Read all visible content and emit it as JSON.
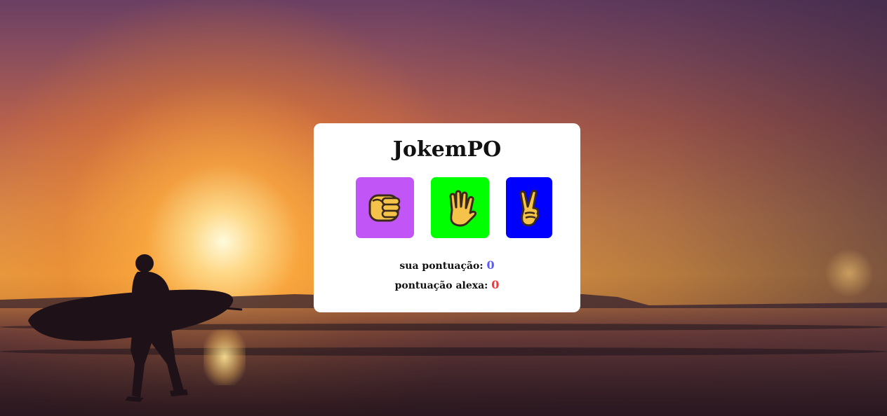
{
  "page": {
    "background": "sunset-beach-surfer"
  },
  "game": {
    "title": "JokemPO",
    "choices": [
      {
        "name": "rock",
        "icon": "fist-icon",
        "color": "#c155f5"
      },
      {
        "name": "paper",
        "icon": "raised-hand-icon",
        "color": "#00ff00"
      },
      {
        "name": "scissors",
        "icon": "victory-hand-icon",
        "color": "#0000ff"
      }
    ],
    "score": {
      "user_label": "sua pontuação:",
      "user_value": "0",
      "user_color": "#5a5aff",
      "alexa_label": "pontuação alexa:",
      "alexa_value": "0",
      "alexa_color": "#ff3333"
    }
  }
}
